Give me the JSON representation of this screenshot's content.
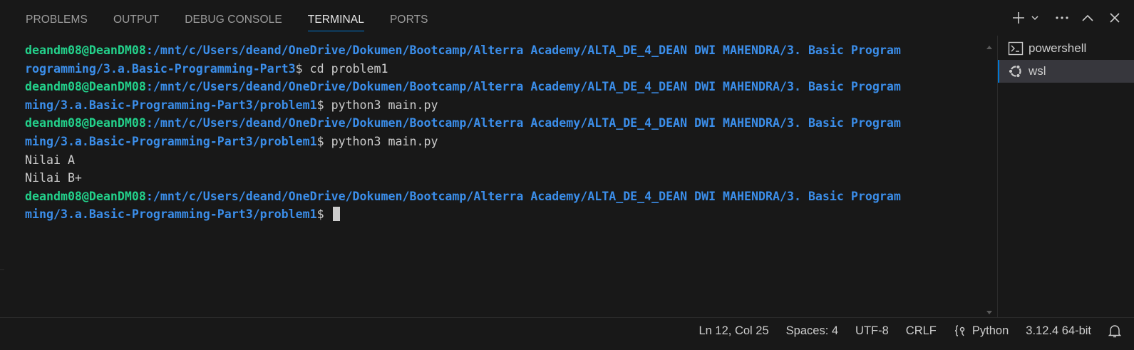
{
  "panel": {
    "tabs": [
      {
        "label": "PROBLEMS",
        "active": false
      },
      {
        "label": "OUTPUT",
        "active": false
      },
      {
        "label": "DEBUG CONSOLE",
        "active": false
      },
      {
        "label": "TERMINAL",
        "active": true
      },
      {
        "label": "PORTS",
        "active": false
      }
    ],
    "actions": [
      "plus-icon",
      "chevron-down-icon",
      "ellipsis-icon",
      "maximize-icon",
      "close-icon"
    ]
  },
  "terminal": {
    "lines": [
      [
        {
          "t": "deandm08@DeanDM08",
          "c": "user"
        },
        {
          "t": ":/mnt/c/Users/deand/OneDrive/Dokumen/Bootcamp/Alterra Academy/ALTA_DE_4_DEAN DWI MAHENDRA/3. Basic Program",
          "c": "path"
        }
      ],
      [
        {
          "t": "rogramming/3.a.Basic-Programming-Part3",
          "c": "path"
        },
        {
          "t": "$ cd problem1",
          "c": "plain"
        }
      ],
      [
        {
          "t": "deandm08@DeanDM08",
          "c": "user"
        },
        {
          "t": ":/mnt/c/Users/deand/OneDrive/Dokumen/Bootcamp/Alterra Academy/ALTA_DE_4_DEAN DWI MAHENDRA/3. Basic Program",
          "c": "path"
        }
      ],
      [
        {
          "t": "ming/3.a.Basic-Programming-Part3/problem1",
          "c": "path"
        },
        {
          "t": "$ python3 main.py",
          "c": "plain"
        }
      ],
      [
        {
          "t": "deandm08@DeanDM08",
          "c": "user"
        },
        {
          "t": ":/mnt/c/Users/deand/OneDrive/Dokumen/Bootcamp/Alterra Academy/ALTA_DE_4_DEAN DWI MAHENDRA/3. Basic Program",
          "c": "path"
        }
      ],
      [
        {
          "t": "ming/3.a.Basic-Programming-Part3/problem1",
          "c": "path"
        },
        {
          "t": "$ python3 main.py",
          "c": "plain"
        }
      ],
      [
        {
          "t": "Nilai A",
          "c": "plain"
        }
      ],
      [
        {
          "t": "Nilai B+",
          "c": "plain"
        }
      ],
      [
        {
          "t": "deandm08@DeanDM08",
          "c": "user"
        },
        {
          "t": ":/mnt/c/Users/deand/OneDrive/Dokumen/Bootcamp/Alterra Academy/ALTA_DE_4_DEAN DWI MAHENDRA/3. Basic Program",
          "c": "path"
        }
      ],
      [
        {
          "t": "ming/3.a.Basic-Programming-Part3/problem1",
          "c": "path"
        },
        {
          "t": "$ ",
          "c": "plain"
        },
        {
          "cursor": true
        }
      ]
    ],
    "colors": {
      "user": "#23d18b",
      "path": "#3b8eea",
      "plain": "#cccccc",
      "accent": "#0078d4"
    }
  },
  "terminal_list": [
    {
      "label": "powershell",
      "icon": "terminal-icon",
      "selected": false
    },
    {
      "label": "wsl",
      "icon": "ubuntu-icon",
      "selected": true
    }
  ],
  "status_bar": {
    "position": "Ln 12, Col 25",
    "spaces": "Spaces: 4",
    "encoding": "UTF-8",
    "eol": "CRLF",
    "language": "Python",
    "interpreter": "3.12.4 64-bit",
    "notifications_icon": "bell-icon"
  }
}
